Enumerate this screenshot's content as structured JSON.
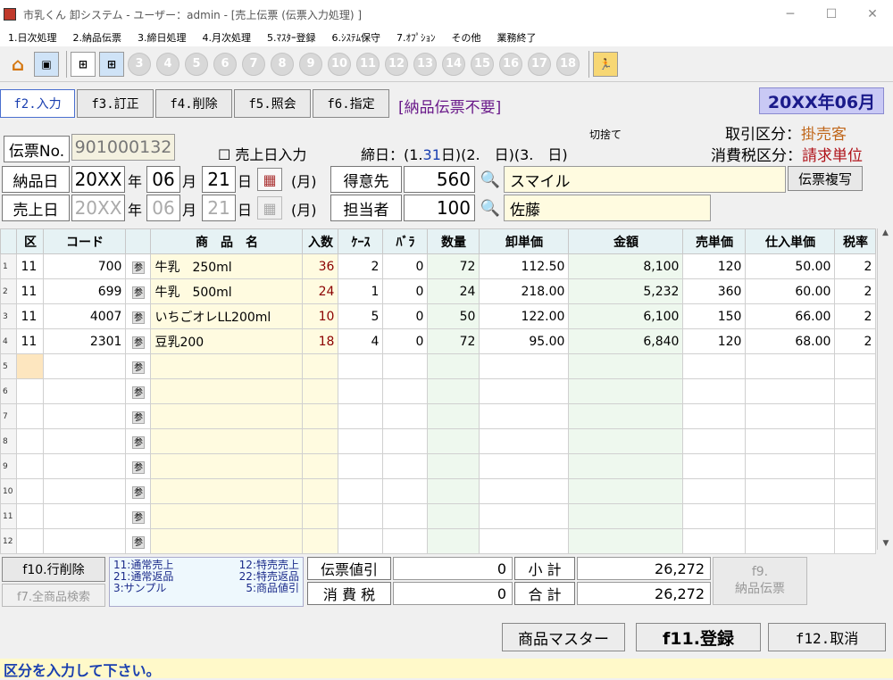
{
  "window": {
    "title": "市乳くん 卸システム - ユーザー：admin - [売上伝票 (伝票入力処理) ]"
  },
  "menu": [
    "1.日次処理",
    "2.納品伝票",
    "3.締日処理",
    "4.月次処理",
    "5.ﾏｽﾀｰ登録",
    "6.ｼｽﾃﾑ保守",
    "7.ｵﾌﾟｼｮﾝ",
    "その他",
    "業務終了"
  ],
  "toolbar": {
    "numbers": [
      "3",
      "4",
      "5",
      "6",
      "7",
      "8",
      "9",
      "10",
      "11",
      "12",
      "13",
      "14",
      "15",
      "16",
      "17",
      "18"
    ]
  },
  "fkeys": {
    "f2": "f2.入力",
    "f3": "f3.訂正",
    "f4": "f4.削除",
    "f5": "f5.照会",
    "f6": "f6.指定"
  },
  "notice": "[納品伝票不要]",
  "period": "20XX年06月",
  "slip": {
    "label": "伝票No.",
    "number": "901000132",
    "sales_date_check": "☐ 売上日入力",
    "closing_label": "締日：(1.",
    "closing_day1": "31",
    "closing_mid": "日)(2.　日)(3.　日)",
    "kirisute": "切捨て"
  },
  "transaction": {
    "label": "取引区分：",
    "value": "掛売客"
  },
  "tax_class": {
    "label": "消費税区分：",
    "value": "請求単位"
  },
  "delivery_date": {
    "label": "納品日",
    "year": "20XX",
    "y_unit": "年",
    "month": "06",
    "m_unit": "月",
    "day": "21",
    "d_unit": "日",
    "weekday": "(月)"
  },
  "sales_date": {
    "label": "売上日",
    "year": "20XX",
    "y_unit": "年",
    "month": "06",
    "m_unit": "月",
    "day": "21",
    "d_unit": "日",
    "weekday": "(月)"
  },
  "customer": {
    "label": "得意先",
    "code": "560",
    "name": "スマイル"
  },
  "staff": {
    "label": "担当者",
    "code": "100",
    "name": "佐藤"
  },
  "copy_button": "伝票複写",
  "table": {
    "headers": [
      "区",
      "コード",
      "商　品　名",
      "入数",
      "ｹｰｽ",
      "ﾊﾞﾗ",
      "数量",
      "卸単価",
      "金額",
      "売単価",
      "仕入単価",
      "税率"
    ],
    "rows": [
      {
        "n": "1",
        "ku": "11",
        "code": "700",
        "name": "牛乳　250ml",
        "irisu": "36",
        "case": "2",
        "bara": "0",
        "qty": "72",
        "price": "112.50",
        "amount": "8,100",
        "sell": "120",
        "cost": "50.00",
        "tax": "2"
      },
      {
        "n": "2",
        "ku": "11",
        "code": "699",
        "name": "牛乳　500ml",
        "irisu": "24",
        "case": "1",
        "bara": "0",
        "qty": "24",
        "price": "218.00",
        "amount": "5,232",
        "sell": "360",
        "cost": "60.00",
        "tax": "2"
      },
      {
        "n": "3",
        "ku": "11",
        "code": "4007",
        "name": "いちごオレLL200ml",
        "irisu": "10",
        "case": "5",
        "bara": "0",
        "qty": "50",
        "price": "122.00",
        "amount": "6,100",
        "sell": "150",
        "cost": "66.00",
        "tax": "2"
      },
      {
        "n": "4",
        "ku": "11",
        "code": "2301",
        "name": "豆乳200",
        "irisu": "18",
        "case": "4",
        "bara": "0",
        "qty": "72",
        "price": "95.00",
        "amount": "6,840",
        "sell": "120",
        "cost": "68.00",
        "tax": "2"
      },
      {
        "n": "5",
        "ku": "",
        "code": "",
        "name": "",
        "irisu": "",
        "case": "",
        "bara": "",
        "qty": "",
        "price": "",
        "amount": "",
        "sell": "",
        "cost": "",
        "tax": ""
      },
      {
        "n": "6",
        "ku": "",
        "code": "",
        "name": "",
        "irisu": "",
        "case": "",
        "bara": "",
        "qty": "",
        "price": "",
        "amount": "",
        "sell": "",
        "cost": "",
        "tax": ""
      },
      {
        "n": "7",
        "ku": "",
        "code": "",
        "name": "",
        "irisu": "",
        "case": "",
        "bara": "",
        "qty": "",
        "price": "",
        "amount": "",
        "sell": "",
        "cost": "",
        "tax": ""
      },
      {
        "n": "8",
        "ku": "",
        "code": "",
        "name": "",
        "irisu": "",
        "case": "",
        "bara": "",
        "qty": "",
        "price": "",
        "amount": "",
        "sell": "",
        "cost": "",
        "tax": ""
      },
      {
        "n": "9",
        "ku": "",
        "code": "",
        "name": "",
        "irisu": "",
        "case": "",
        "bara": "",
        "qty": "",
        "price": "",
        "amount": "",
        "sell": "",
        "cost": "",
        "tax": ""
      },
      {
        "n": "10",
        "ku": "",
        "code": "",
        "name": "",
        "irisu": "",
        "case": "",
        "bara": "",
        "qty": "",
        "price": "",
        "amount": "",
        "sell": "",
        "cost": "",
        "tax": ""
      },
      {
        "n": "11",
        "ku": "",
        "code": "",
        "name": "",
        "irisu": "",
        "case": "",
        "bara": "",
        "qty": "",
        "price": "",
        "amount": "",
        "sell": "",
        "cost": "",
        "tax": ""
      },
      {
        "n": "12",
        "ku": "",
        "code": "",
        "name": "",
        "irisu": "",
        "case": "",
        "bara": "",
        "qty": "",
        "price": "",
        "amount": "",
        "sell": "",
        "cost": "",
        "tax": ""
      }
    ],
    "ref_glyph": "参"
  },
  "bottom": {
    "row_delete": "f10.行削除",
    "all_search": "f7.全商品検索",
    "legend": [
      [
        "11:通常売上",
        "12:特売売上"
      ],
      [
        "21:通常返品",
        "22:特売返品"
      ],
      [
        "3:サンプル",
        "5:商品値引"
      ]
    ],
    "discount_label": "伝票値引",
    "discount_value": "0",
    "subtotal_label": "小 計",
    "subtotal_value": "26,272",
    "tax_label": "消 費 税",
    "tax_value": "0",
    "total_label": "合 計",
    "total_value": "26,272",
    "f9_line1": "f9.",
    "f9_line2": "納品伝票"
  },
  "actions": {
    "master": "商品マスター",
    "register": "f11.登録",
    "cancel": "f12.取消"
  },
  "status": "区分を入力して下さい。"
}
